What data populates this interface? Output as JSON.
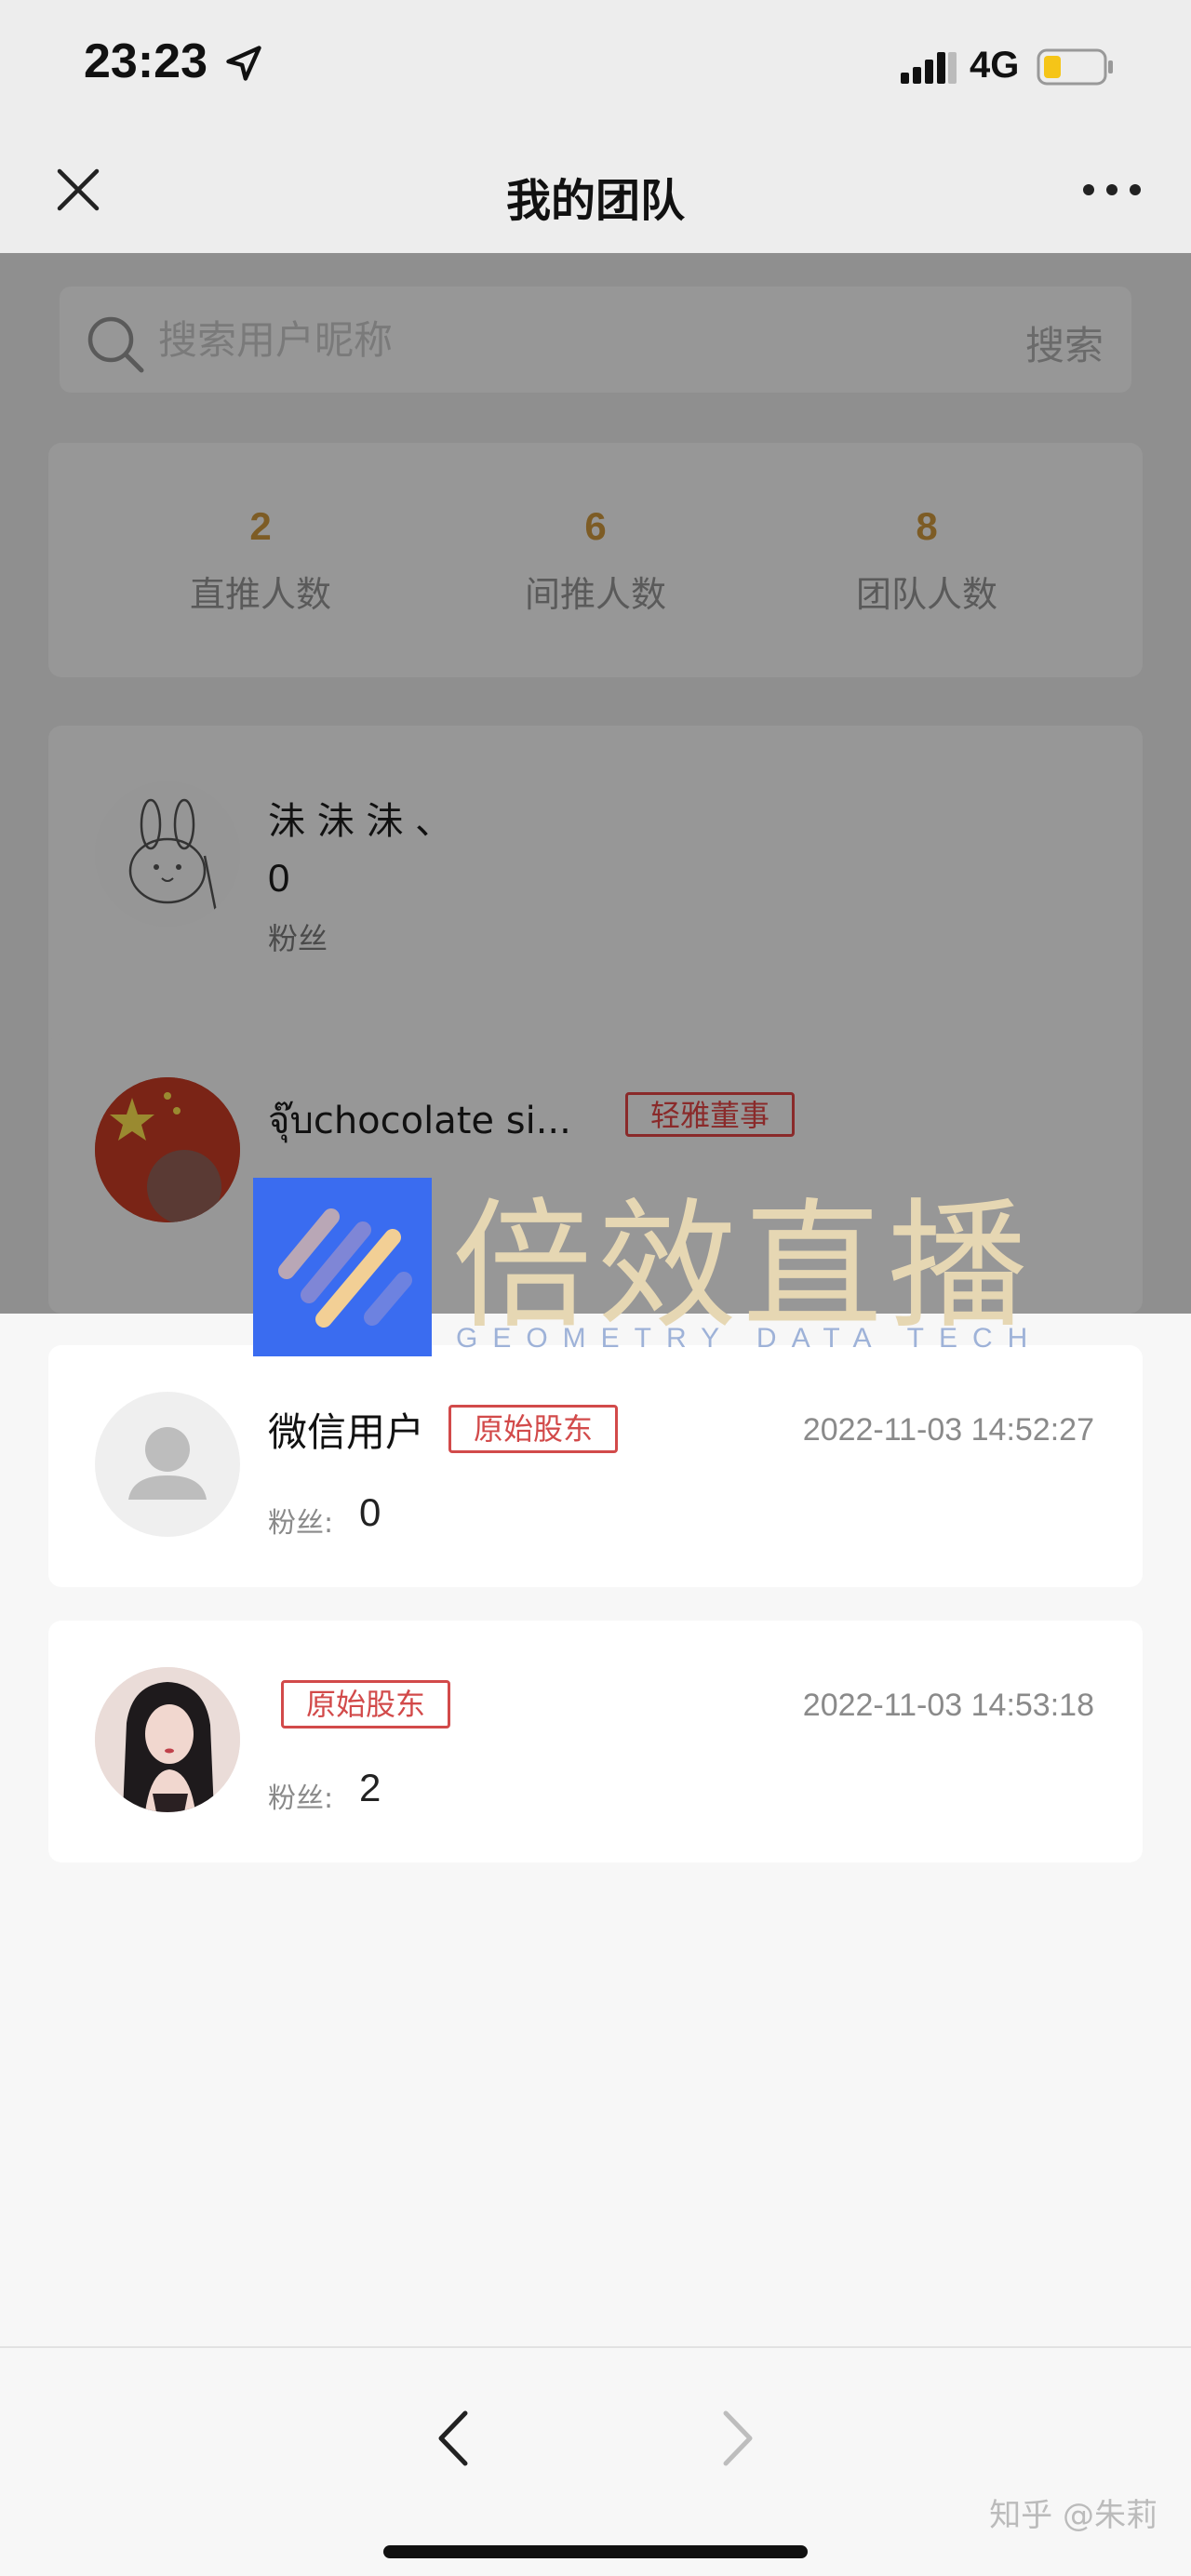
{
  "status_bar": {
    "time": "23:23",
    "network": "4G",
    "icons": [
      "location-arrow-icon",
      "signal-icon",
      "battery-icon"
    ]
  },
  "nav": {
    "title": "我的团队",
    "icons": [
      "close-icon",
      "more-icon"
    ]
  },
  "search": {
    "placeholder": "搜索用户昵称",
    "button_label": "搜索"
  },
  "stats": [
    {
      "value": "2",
      "label": "直推人数"
    },
    {
      "value": "6",
      "label": "间推人数"
    },
    {
      "value": "8",
      "label": "团队人数"
    }
  ],
  "background_members": [
    {
      "name": "沬 沬 沬 、",
      "count": "0",
      "fans_label": "粉丝"
    },
    {
      "name": "จุ๊บchocolate si...",
      "badge": "轻雅董事"
    }
  ],
  "watermark": {
    "title": "倍效直播",
    "subtitle": "GEOMETRY DATA TECH"
  },
  "members": [
    {
      "name": "微信用户",
      "badge": "原始股东",
      "time": "2022-11-03 14:52:27",
      "fans_label": "粉丝:",
      "fans": "0"
    },
    {
      "name": "",
      "badge": "原始股东",
      "time": "2022-11-03 14:53:18",
      "fans_label": "粉丝:",
      "fans": "2"
    }
  ],
  "footer": {
    "credit": "知乎 @朱莉"
  },
  "colors": {
    "accent_gold": "#7d5c25",
    "badge_red": "#d24a4a",
    "dim_overlay": "#8f8f8f"
  }
}
